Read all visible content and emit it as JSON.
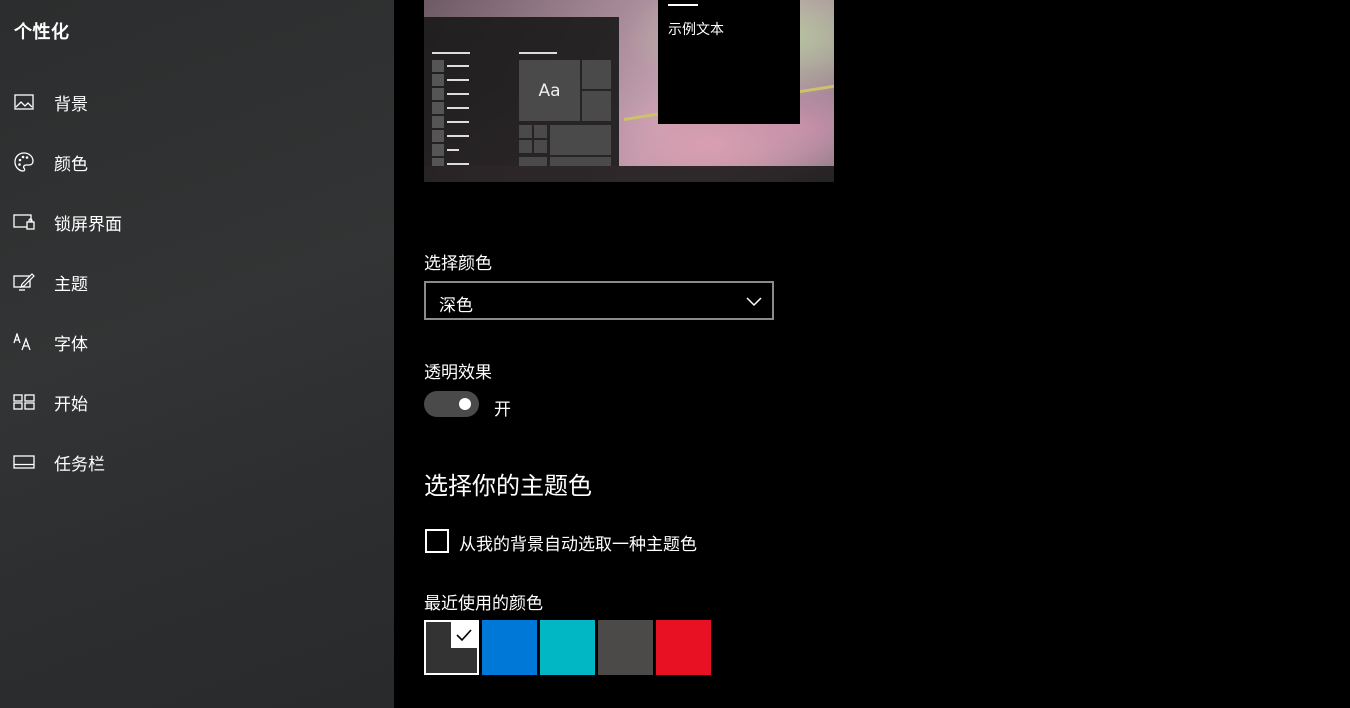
{
  "sidebar": {
    "title": "个性化",
    "items": [
      {
        "label": "背景",
        "icon": "image-icon"
      },
      {
        "label": "颜色",
        "icon": "palette-icon"
      },
      {
        "label": "锁屏界面",
        "icon": "lock-screen-icon"
      },
      {
        "label": "主题",
        "icon": "theme-icon"
      },
      {
        "label": "字体",
        "icon": "font-icon"
      },
      {
        "label": "开始",
        "icon": "start-icon"
      },
      {
        "label": "任务栏",
        "icon": "taskbar-icon"
      }
    ]
  },
  "preview": {
    "tile_text": "Aa",
    "window_text": "示例文本"
  },
  "choose_color": {
    "label": "选择颜色",
    "value": "深色"
  },
  "transparency": {
    "label": "透明效果",
    "state": "开"
  },
  "accent": {
    "heading": "选择你的主题色",
    "auto_pick_label": "从我的背景自动选取一种主题色",
    "recent_label": "最近使用的颜色",
    "recent_colors": [
      "#333333",
      "#0078d7",
      "#00b7c3",
      "#4c4a48",
      "#e81123"
    ],
    "selected_index": 0
  }
}
